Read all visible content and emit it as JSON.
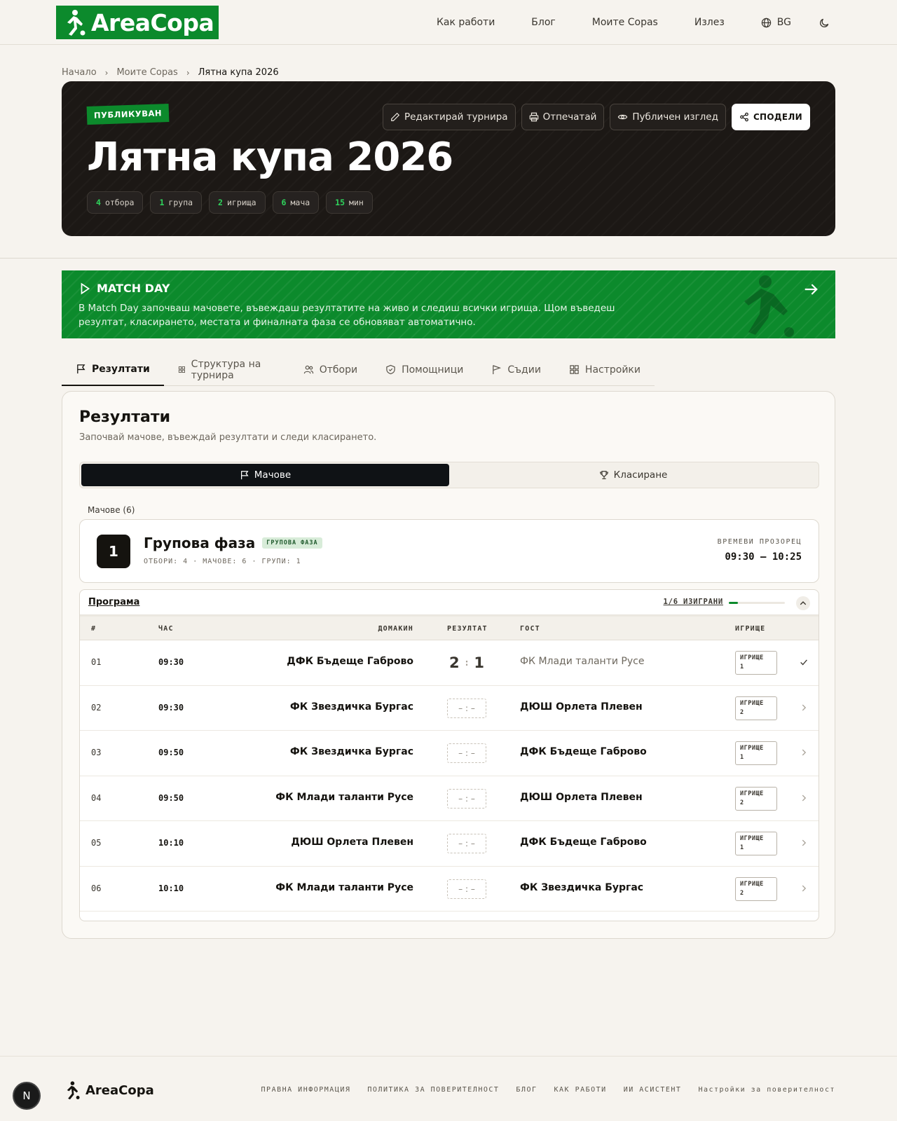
{
  "header": {
    "logo_text": "AreaCopa",
    "nav": {
      "how_it_works": "Как работи",
      "blog": "Блог",
      "my_copas": "Моите Copas",
      "logout": "Излез",
      "lang": "BG"
    }
  },
  "breadcrumb": [
    "Начало",
    "Моите Copas",
    "Лятна купа 2026"
  ],
  "hero": {
    "status": "ПУБЛИКУВАН",
    "title": "Лятна купа 2026",
    "stats": [
      {
        "n": "4",
        "label": "отбора"
      },
      {
        "n": "1",
        "label": "група"
      },
      {
        "n": "2",
        "label": "игрища"
      },
      {
        "n": "6",
        "label": "мача"
      },
      {
        "n": "15",
        "label": "мин"
      }
    ],
    "actions": {
      "edit": "Редактирай турнира",
      "print": "Отпечатай",
      "public_view": "Публичен изглед",
      "share": "СПОДЕЛИ"
    }
  },
  "matchday": {
    "title": "MATCH DAY",
    "text": "В Match Day започваш мачовете, въвеждаш резултатите на живо и следиш всички игрища. Щом въведеш резултат, класирането, местата и финалната фаза се обновяват автоматично."
  },
  "tabs": [
    "Резултати",
    "Структура на турнира",
    "Отбори",
    "Помощници",
    "Съдии",
    "Настройки"
  ],
  "results": {
    "title": "Резултати",
    "subtitle": "Започвай мачове, въвеждай резултати и следи класирането.",
    "seg_matches": "Мачове",
    "seg_standings": "Класиране",
    "matches_count": "Мачове (6)"
  },
  "phase": {
    "number": "1",
    "name": "Групова фаза",
    "tag": "ГРУПОВА ФАЗА",
    "meta": "ОТБОРИ: 4 · МАЧОВЕ: 6 · ГРУПИ: 1",
    "window_label": "ВРЕМЕВИ ПРОЗОРЕЦ",
    "window_value": "09:30 – 10:25"
  },
  "schedule": {
    "title": "Програма",
    "played": "1/6 ИЗИГРАНИ",
    "played_fraction": 0.1667,
    "columns": {
      "num": "#",
      "time": "ЧАС",
      "home": "ДОМАКИН",
      "score": "РЕЗУЛТАТ",
      "away": "ГОСТ",
      "pitch": "ИГРИЩЕ"
    },
    "pitch_label": "ИГРИЩЕ",
    "empty_score": "– : –",
    "rows": [
      {
        "num": "01",
        "time": "09:30",
        "home": "ДФК Бъдеще Габрово",
        "home_score": "2",
        "away_score": "1",
        "away": "ФК Млади таланти Русе",
        "pitch": "1",
        "done": true
      },
      {
        "num": "02",
        "time": "09:30",
        "home": "ФК Звездичка Бургас",
        "away": "ДЮШ Орлета Плевен",
        "pitch": "2",
        "done": false
      },
      {
        "num": "03",
        "time": "09:50",
        "home": "ФК Звездичка Бургас",
        "away": "ДФК Бъдеще Габрово",
        "pitch": "1",
        "done": false
      },
      {
        "num": "04",
        "time": "09:50",
        "home": "ФК Млади таланти Русе",
        "away": "ДЮШ Орлета Плевен",
        "pitch": "2",
        "done": false
      },
      {
        "num": "05",
        "time": "10:10",
        "home": "ДЮШ Орлета Плевен",
        "away": "ДФК Бъдеще Габрово",
        "pitch": "1",
        "done": false
      },
      {
        "num": "06",
        "time": "10:10",
        "home": "ФК Млади таланти Русе",
        "away": "ФК Звездичка Бургас",
        "pitch": "2",
        "done": false
      }
    ]
  },
  "footer": {
    "logo_text": "AreaCopa",
    "links": [
      "ПРАВНА ИНФОРМАЦИЯ",
      "ПОЛИТИКА ЗА ПОВЕРИТЕЛНОСТ",
      "БЛОГ",
      "КАК РАБОТИ",
      "ИИ АСИСТЕНТ",
      "Настройки за поверителност"
    ]
  },
  "dev_badge": "N",
  "colors": {
    "brand_green": "#0c8a2c",
    "hero_bg": "#1c1815",
    "page_bg": "#f6f3ee"
  }
}
